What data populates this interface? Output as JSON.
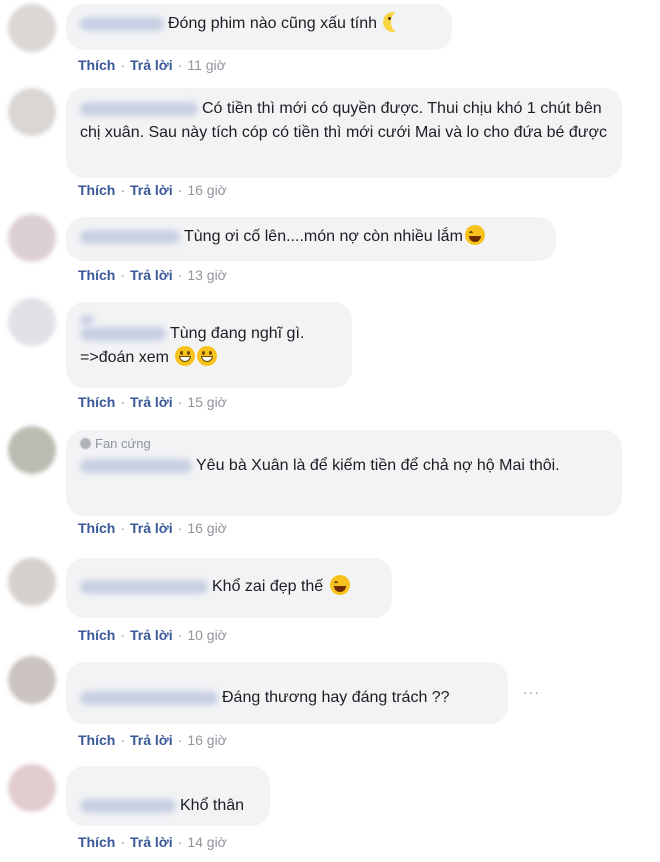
{
  "actions": {
    "like": "Thích",
    "reply": "Trả lời",
    "separator": "·"
  },
  "comments": [
    {
      "text": "Đóng phim nào cũng xấu tính",
      "time": "11 giờ",
      "emoji": "moon-emoji"
    },
    {
      "text": "Có tiền thì mới có quyền được. Thui chịu khó 1 chút bên chị xuân. Sau này tích cóp có tiền thì mới cưới Mai và lo cho đứa bé được",
      "time": "16 giờ"
    },
    {
      "text": "Tùng ơi cố lên....món nợ còn nhiều lắm",
      "time": "13 giờ",
      "emoji": "laughing-emoji"
    },
    {
      "line1": "Tùng đang nghĩ gì.",
      "line2": "=>đoán xem",
      "time": "15 giờ",
      "emoji": "grinning-emoji"
    },
    {
      "badge": "Fan cứng",
      "text": "Yêu bà Xuân là để kiếm tiền để chả nợ hộ Mai thôi.",
      "time": "16 giờ"
    },
    {
      "text": "Khổ zai đẹp thế",
      "time": "10 giờ",
      "emoji": "laughing-emoji"
    },
    {
      "text": "Đáng thương hay đáng trách ??",
      "time": "16 giờ",
      "more": "···"
    },
    {
      "text": "Khổ thân",
      "time": "14 giờ"
    }
  ]
}
